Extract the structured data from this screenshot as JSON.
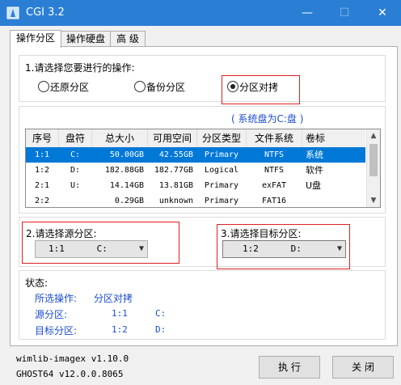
{
  "window": {
    "title": "CGI 3.2",
    "min": "—",
    "max": "☐",
    "close": "✕"
  },
  "tabs": [
    "操作分区",
    "操作硬盘",
    "高 级"
  ],
  "operation": {
    "prompt": "1.请选择您要进行的操作:",
    "options": [
      "还原分区",
      "备份分区",
      "分区对拷"
    ],
    "selected_index": 2
  },
  "system_disk": "( 系统盘为C:盘 )",
  "table": {
    "headers": [
      "序号",
      "盘符",
      "总大小",
      "可用空间",
      "分区类型",
      "文件系统",
      "卷标"
    ],
    "rows": [
      [
        "1:1",
        "C:",
        "50.00GB",
        "42.55GB",
        "Primary",
        "NTFS",
        "系统"
      ],
      [
        "1:2",
        "D:",
        "182.88GB",
        "182.77GB",
        "Logical",
        "NTFS",
        "软件"
      ],
      [
        "2:1",
        "U:",
        "14.14GB",
        "13.81GB",
        "Primary",
        "exFAT",
        "U盘"
      ],
      [
        "2:2",
        "",
        "0.29GB",
        "unknown",
        "Primary",
        "FAT16",
        ""
      ]
    ],
    "selected_row": 0
  },
  "source": {
    "prompt": "2.请选择源分区:",
    "value": "1:1      C:"
  },
  "target": {
    "prompt": "3.请选择目标分区:",
    "value": "1:2      D:"
  },
  "status": {
    "title": "状态:",
    "operation_label": "所选操作:",
    "operation_value": "分区对拷",
    "source_label": "源分区:",
    "source_id": "1:1",
    "source_drive": "C:",
    "target_label": "目标分区:",
    "target_id": "1:2",
    "target_drive": "D:"
  },
  "footer": {
    "line1": "wimlib-imagex v1.10.0",
    "line2": "GHOST64 v12.0.0.8065",
    "execute": "执 行",
    "close": "关 闭"
  },
  "colors": {
    "titlebar": "#2a7fd4",
    "selection": "#0078d7",
    "highlight_box": "#e02020",
    "status_text": "#1a4dcc"
  }
}
